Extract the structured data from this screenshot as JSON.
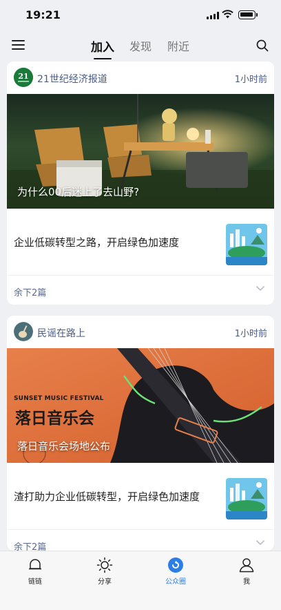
{
  "status_bar": {
    "time": "19:21"
  },
  "top_nav": {
    "tabs": [
      {
        "label": "加入",
        "active": true
      },
      {
        "label": "发现",
        "active": false
      },
      {
        "label": "附近",
        "active": false
      }
    ]
  },
  "feed": [
    {
      "source": {
        "name": "21世纪经济报道",
        "avatar_text": "21",
        "avatar_color": "#1a7a3a"
      },
      "time": "1小时前",
      "hero": {
        "title": "为什么00后迷上了去山野?"
      },
      "article": {
        "title": "企业低碳转型之路，开启绿色加速度"
      },
      "more": "余下2篇"
    },
    {
      "source": {
        "name": "民谣在路上"
      },
      "time": "1小时前",
      "hero": {
        "title": "落日音乐会场地公布",
        "banner_en": "SUNSET MUSIC FESTIVAL",
        "banner_cn": "落日音乐会"
      },
      "article": {
        "title": "渣打助力企业低碳转型，开启绿色加速度"
      },
      "more": "余下2篇"
    }
  ],
  "bottom_tabs": [
    {
      "label": "链链",
      "icon": "bell-icon",
      "active": false
    },
    {
      "label": "分享",
      "icon": "sun-icon",
      "active": false
    },
    {
      "label": "公众圈",
      "icon": "circle-icon",
      "active": true
    },
    {
      "label": "我",
      "icon": "person-icon",
      "active": false
    }
  ],
  "colors": {
    "accent": "#2d7de6",
    "source": "#4a5c86"
  }
}
